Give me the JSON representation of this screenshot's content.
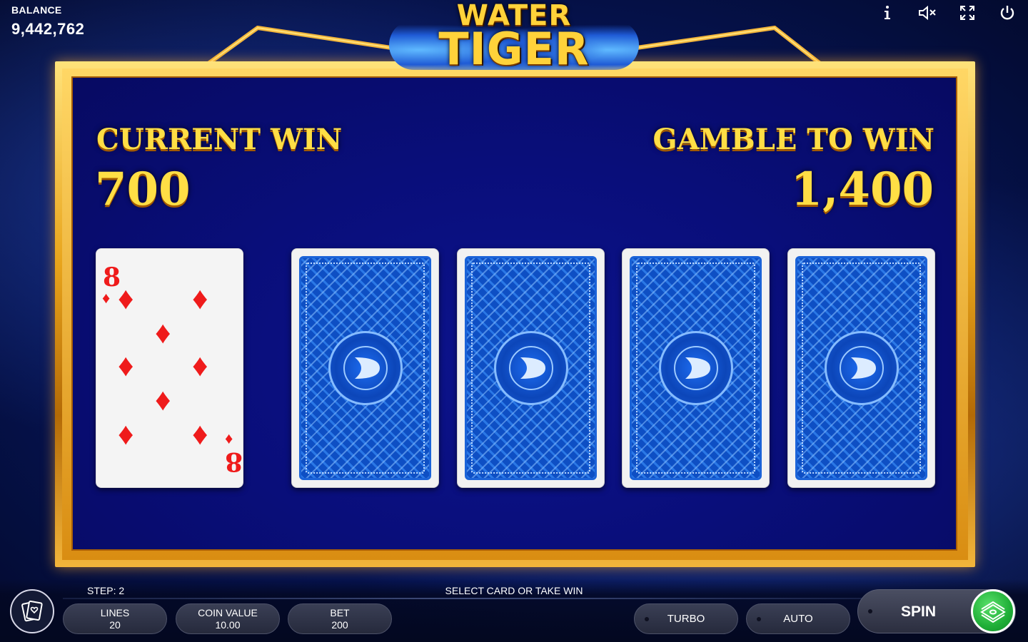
{
  "header": {
    "balance_label": "BALANCE",
    "balance_value": "9,442,762",
    "icons": [
      "info-icon",
      "sound-muted-icon",
      "fullscreen-icon",
      "power-icon"
    ]
  },
  "logo": {
    "line1": "WATER",
    "line2": "TIGER"
  },
  "gamble": {
    "current_win_label": "CURRENT WIN",
    "current_win_value": "700",
    "gamble_to_win_label": "GAMBLE TO WIN",
    "gamble_to_win_value": "1,400",
    "dealer_card": {
      "rank": "8",
      "suit": "diamonds",
      "suit_symbol": "♦"
    },
    "hidden_cards_count": 4
  },
  "bottom": {
    "step_text": "STEP: 2",
    "message": "SELECT CARD OR TAKE WIN",
    "lines_label": "LINES",
    "lines_value": "20",
    "coin_value_label": "COIN VALUE",
    "coin_value_value": "10.00",
    "bet_label": "BET",
    "bet_value": "200",
    "turbo_label": "TURBO",
    "auto_label": "AUTO",
    "spin_label": "SPIN"
  },
  "colors": {
    "gold_text": "#ffde45",
    "panel_blue": "#0a0f82",
    "card_red": "#ef1b1b",
    "spin_green": "#1fae37"
  }
}
